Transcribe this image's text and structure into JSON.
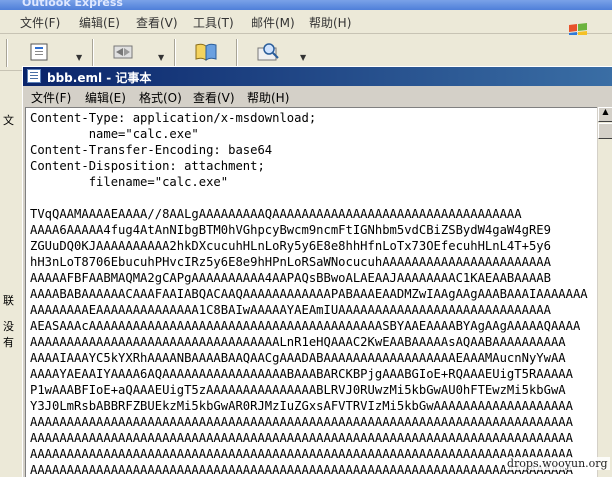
{
  "outlook": {
    "title": "Outlook Express",
    "menus": [
      "文件(F)",
      "编辑(E)",
      "查看(V)",
      "工具(T)",
      "邮件(M)",
      "帮助(H)"
    ],
    "left_fragments": [
      "文",
      "联",
      "没有"
    ]
  },
  "notepad": {
    "title": "bbb.eml - 记事本",
    "menus": [
      "文件(F)",
      "编辑(E)",
      "格式(O)",
      "查看(V)",
      "帮助(H)"
    ],
    "lines": [
      "Content-Type: application/x-msdownload;",
      "        name=\"calc.exe\"",
      "Content-Transfer-Encoding: base64",
      "Content-Disposition: attachment;",
      "        filename=\"calc.exe\"",
      "",
      "TVqQAAMAAAAEAAAA//8AALgAAAAAAAAAQAAAAAAAAAAAAAAAAAAAAAAAAAAAAAAAAAA",
      "AAAA6AAAAA4fug4AtAnNIbgBTM0hVGhpcyBwcm9ncmFtIGNhbm5vdCBiZSBydW4gaW4gRE9",
      "ZGUuDQ0KJAAAAAAAAAA2hkDXcucuhHLnLoRy5y6E8e8hhHfnLoTx73OEfecuhHLnL4T+5y6",
      "hH3nLoT8706EbucuhPHvcIRz5y6E8e9hHPnLoRSaWNocucuhAAAAAAAAAAAAAAAAAAAAAAA",
      "AAAAAFBFAABMAQMA2gCAPgAAAAAAAAAA4AAPAQsBBwoALAEAAJAAAAAAAAC1KAEAABAAAAB",
      "AAAABABAAAAAACAAAFAAIABQACAAQAAAAAAAAAAAAPABAAAEAADMZwIAAgAAgAAABAAAIAAAAAAA",
      "AAAAAAAAEAAAAAAAAAAAAAA1C8BAIwAAAAAYAEAmIUAAAAAAAAAAAAAAAAAAAAAAAAAAAAA",
      "AEASAAAcAAAAAAAAAAAAAAAAAAAAAAAAAAAAAAAAAAAAAAAASBYAAEAAAABYAgAAgAAAAAQAAAA",
      "AAAAAAAAAAAAAAAAAAAAAAAAAAAAAAAAAALnR1eHQAAAC2KwEAABAAAAAsAQAABAAAAAAAAAA",
      "AAAAIAAAYC5kYXRhAAAANBAAAABAAQAACgAAADABAAAAAAAAAAAAAAAAAAEAAAMAucnNyYwAA",
      "AAAAYAEAAIYAAAA6AQAAAAAAAAAAAAAAAAABAAABARCKBPjgAAABGIoE+RQAAAEUigT5RAAAAA",
      "P1wAAABFIoE+aQAAAEUigT5zAAAAAAAAAAAAAAABLRVJ0RUwzMi5kbGwAU0hFTEwzMi5kbGwA",
      "Y3J0LmRsbABBRFZBUEkzMi5kbGwAR0RJMzIuZGxsAFVTRVIzMi5kbGwAAAAAAAAAAAAAAAAAAA",
      "AAAAAAAAAAAAAAAAAAAAAAAAAAAAAAAAAAAAAAAAAAAAAAAAAAAAAAAAAAAAAAAAAAAAAAAAAA",
      "AAAAAAAAAAAAAAAAAAAAAAAAAAAAAAAAAAAAAAAAAAAAAAAAAAAAAAAAAAAAAAAAAAAAAAAAAA",
      "AAAAAAAAAAAAAAAAAAAAAAAAAAAAAAAAAAAAAAAAAAAAAAAAAAAAAAAAAAAAAAAAAAAAAAAAAA",
      "AAAAAAAAAAAAAAAAAAAAAAAAAAAAAAAAAAAAAAAAAAAAAAAAAAAAAAAAAAAAAAAAAAAAAAAAAA"
    ]
  },
  "watermark": "drops.wooyun.org",
  "icons": [
    "windows-flag-icon",
    "notepad-icon",
    "scroll-up-arrow-icon",
    "toolbar-new-mail-icon",
    "toolbar-send-receive-icon",
    "toolbar-address-book-icon",
    "toolbar-find-icon"
  ]
}
